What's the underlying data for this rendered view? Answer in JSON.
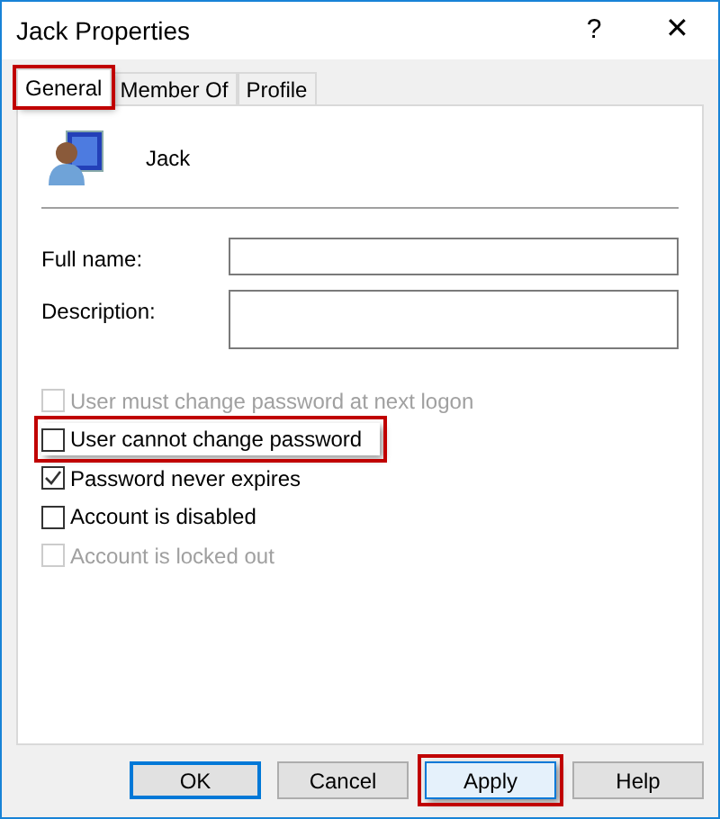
{
  "window": {
    "title": "Jack Properties",
    "help": "?",
    "close": "✕"
  },
  "tabs": [
    {
      "label": "General",
      "selected": true,
      "highlighted": true
    },
    {
      "label": "Member Of",
      "selected": false,
      "highlighted": false
    },
    {
      "label": "Profile",
      "selected": false,
      "highlighted": false
    }
  ],
  "user": {
    "name": "Jack"
  },
  "fields": [
    {
      "label": "Full name:",
      "kind": "single"
    },
    {
      "label": "Description:",
      "kind": "multi"
    }
  ],
  "options": [
    {
      "label": "User must change password at next logon",
      "checked": false,
      "disabled": true,
      "highlighted": false
    },
    {
      "label": "User cannot change password",
      "checked": false,
      "disabled": false,
      "highlighted": true
    },
    {
      "label": "Password never expires",
      "checked": true,
      "disabled": false,
      "highlighted": false
    },
    {
      "label": "Account is disabled",
      "checked": false,
      "disabled": false,
      "highlighted": false
    },
    {
      "label": "Account is locked out",
      "checked": false,
      "disabled": true,
      "highlighted": false
    }
  ],
  "buttons": [
    {
      "label": "OK",
      "default": true,
      "highlighted": false
    },
    {
      "label": "Cancel",
      "default": false,
      "highlighted": false
    },
    {
      "label": "Apply",
      "default": false,
      "highlighted": true
    },
    {
      "label": "Help",
      "default": false,
      "highlighted": false
    }
  ]
}
